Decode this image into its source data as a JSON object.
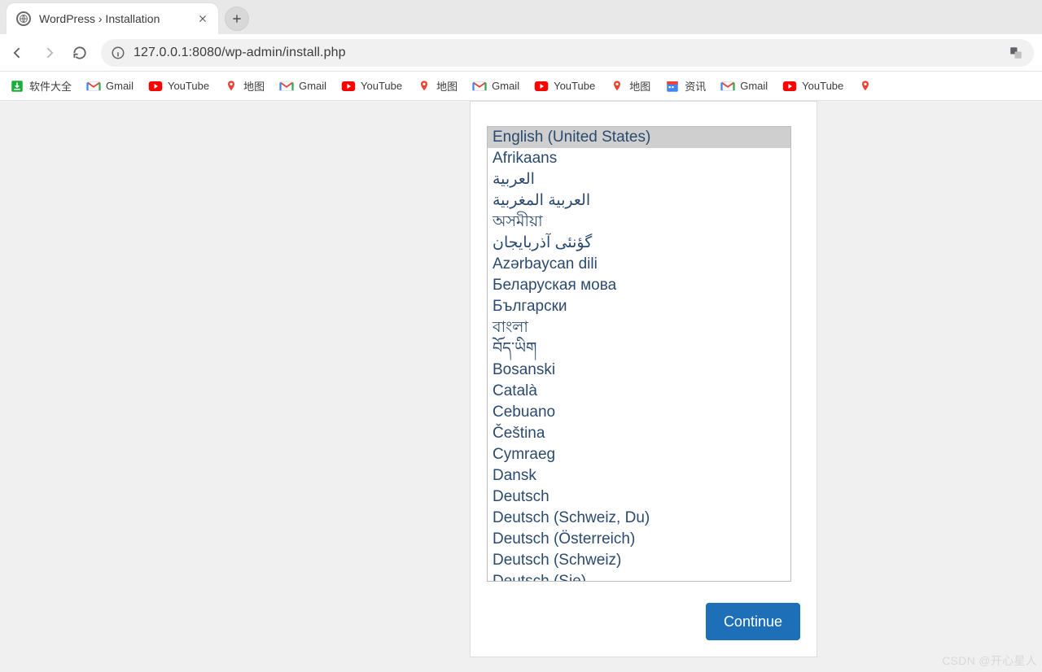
{
  "browser": {
    "tab_title": "WordPress › Installation",
    "url": "127.0.0.1:8080/wp-admin/install.php"
  },
  "bookmarks": [
    {
      "icon": "download",
      "label": "软件大全"
    },
    {
      "icon": "gmail",
      "label": "Gmail"
    },
    {
      "icon": "youtube",
      "label": "YouTube"
    },
    {
      "icon": "maps",
      "label": "地图"
    },
    {
      "icon": "gmail",
      "label": "Gmail"
    },
    {
      "icon": "youtube",
      "label": "YouTube"
    },
    {
      "icon": "maps",
      "label": "地图"
    },
    {
      "icon": "gmail",
      "label": "Gmail"
    },
    {
      "icon": "youtube",
      "label": "YouTube"
    },
    {
      "icon": "maps",
      "label": "地图"
    },
    {
      "icon": "calendar",
      "label": "资讯"
    },
    {
      "icon": "gmail",
      "label": "Gmail"
    },
    {
      "icon": "youtube",
      "label": "YouTube"
    },
    {
      "icon": "maps",
      "label": ""
    }
  ],
  "install": {
    "selected_index": 0,
    "continue_label": "Continue",
    "languages": [
      "English (United States)",
      "Afrikaans",
      "العربية",
      "العربية المغربية",
      "অসমীয়া",
      "گؤنئی آذربایجان",
      "Azərbaycan dili",
      "Беларуская мова",
      "Български",
      "বাংলা",
      "བོད་ཡིག",
      "Bosanski",
      "Català",
      "Cebuano",
      "Čeština",
      "Cymraeg",
      "Dansk",
      "Deutsch",
      "Deutsch (Schweiz, Du)",
      "Deutsch (Österreich)",
      "Deutsch (Schweiz)",
      "Deutsch (Sie)"
    ]
  },
  "watermark": "CSDN @开心星人"
}
